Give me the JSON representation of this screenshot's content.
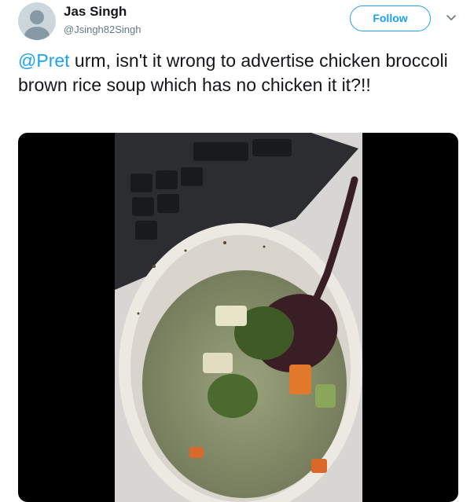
{
  "user": {
    "display_name": "Jas Singh",
    "handle": "@Jsingh82Singh"
  },
  "follow_button": {
    "label": "Follow"
  },
  "tweet": {
    "mention": "@Pret",
    "text": " urm, isn't it wrong to advertise chicken broccoli brown rice soup which has no chicken it it?!!"
  },
  "colors": {
    "accent": "#1da1f2",
    "text": "#14171a",
    "muted": "#657786"
  },
  "icons": {
    "more": "chevron-down-icon"
  }
}
